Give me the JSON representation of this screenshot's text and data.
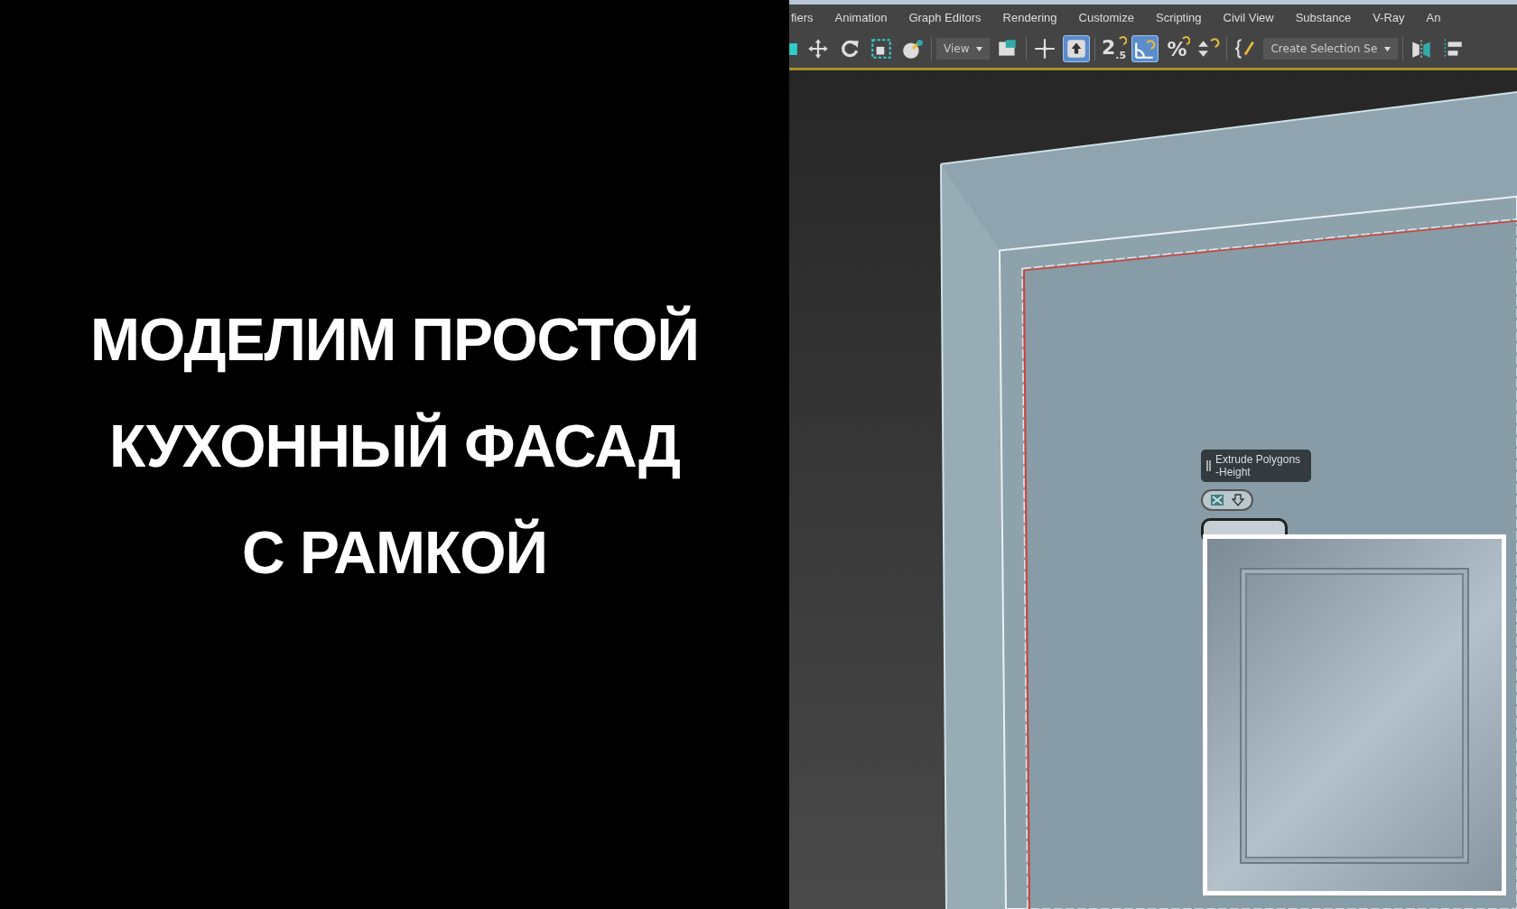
{
  "title": {
    "lines": [
      "МОДЕЛИМ ПРОСТОЙ",
      "КУХОННЫЙ ФАСАД",
      "С РАМКОЙ"
    ]
  },
  "app": {
    "menu": [
      "fiers",
      "Animation",
      "Graph Editors",
      "Rendering",
      "Customize",
      "Scripting",
      "Civil View",
      "Substance",
      "V-Ray",
      "An"
    ],
    "toolbar": [
      {
        "kind": "button",
        "active": false
      },
      {
        "kind": "button",
        "active": false
      },
      {
        "kind": "button",
        "active": false
      },
      {
        "kind": "button",
        "active": false
      },
      {
        "kind": "button",
        "active": false
      },
      {
        "kind": "dropdown",
        "label": "View"
      },
      {
        "kind": "button",
        "active": false
      },
      {
        "kind": "button",
        "active": false
      },
      {
        "kind": "button",
        "active": true
      },
      {
        "kind": "button",
        "active": false,
        "label": "2$_{.5}$"
      },
      {
        "kind": "button",
        "active": true
      },
      {
        "kind": "button",
        "active": false,
        "label": "%"
      },
      {
        "kind": "button",
        "active": false
      },
      {
        "kind": "button",
        "active": false
      },
      {
        "kind": "dropdown",
        "label": "Create Selection Se"
      },
      {
        "kind": "button",
        "active": false
      },
      {
        "kind": "button",
        "active": false
      }
    ],
    "caddy": {
      "title": "Extrude Polygons -Height"
    }
  }
}
